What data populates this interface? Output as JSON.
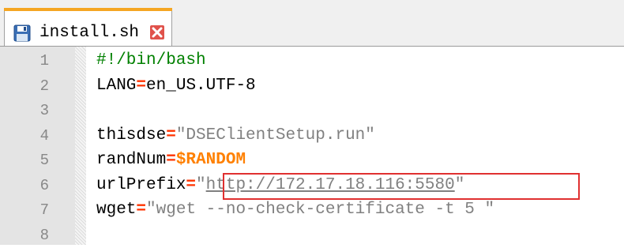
{
  "tab": {
    "title": "install.sh",
    "accent_color": "#f5a623",
    "save_icon": "floppy-disk-icon",
    "close_icon": "close-icon"
  },
  "editor": {
    "lines": [
      {
        "number": "1",
        "tokens": [
          {
            "text": "#!/bin/bash",
            "type": "comment"
          }
        ]
      },
      {
        "number": "2",
        "tokens": [
          {
            "text": "LANG",
            "type": "plain"
          },
          {
            "text": "=",
            "type": "op"
          },
          {
            "text": "en_US.UTF-8",
            "type": "plain"
          }
        ]
      },
      {
        "number": "3",
        "tokens": []
      },
      {
        "number": "4",
        "tokens": [
          {
            "text": "thisdse",
            "type": "plain"
          },
          {
            "text": "=",
            "type": "op"
          },
          {
            "text": "\"DSEClientSetup.run\"",
            "type": "string"
          }
        ]
      },
      {
        "number": "5",
        "tokens": [
          {
            "text": "randNum",
            "type": "plain"
          },
          {
            "text": "=",
            "type": "op"
          },
          {
            "text": "$RANDOM",
            "type": "var"
          }
        ]
      },
      {
        "number": "6",
        "tokens": [
          {
            "text": "urlPrefix",
            "type": "plain"
          },
          {
            "text": "=",
            "type": "op"
          },
          {
            "text": "\"",
            "type": "string"
          },
          {
            "text": "http://172.17.18.116:5580",
            "type": "url"
          },
          {
            "text": "\"",
            "type": "string"
          }
        ]
      },
      {
        "number": "7",
        "tokens": [
          {
            "text": "wget",
            "type": "plain"
          },
          {
            "text": "=",
            "type": "op"
          },
          {
            "text": "\"wget --no-check-certificate -t 5 \"",
            "type": "string"
          }
        ]
      },
      {
        "number": "8",
        "tokens": []
      }
    ],
    "highlight_color": "#e03030"
  }
}
